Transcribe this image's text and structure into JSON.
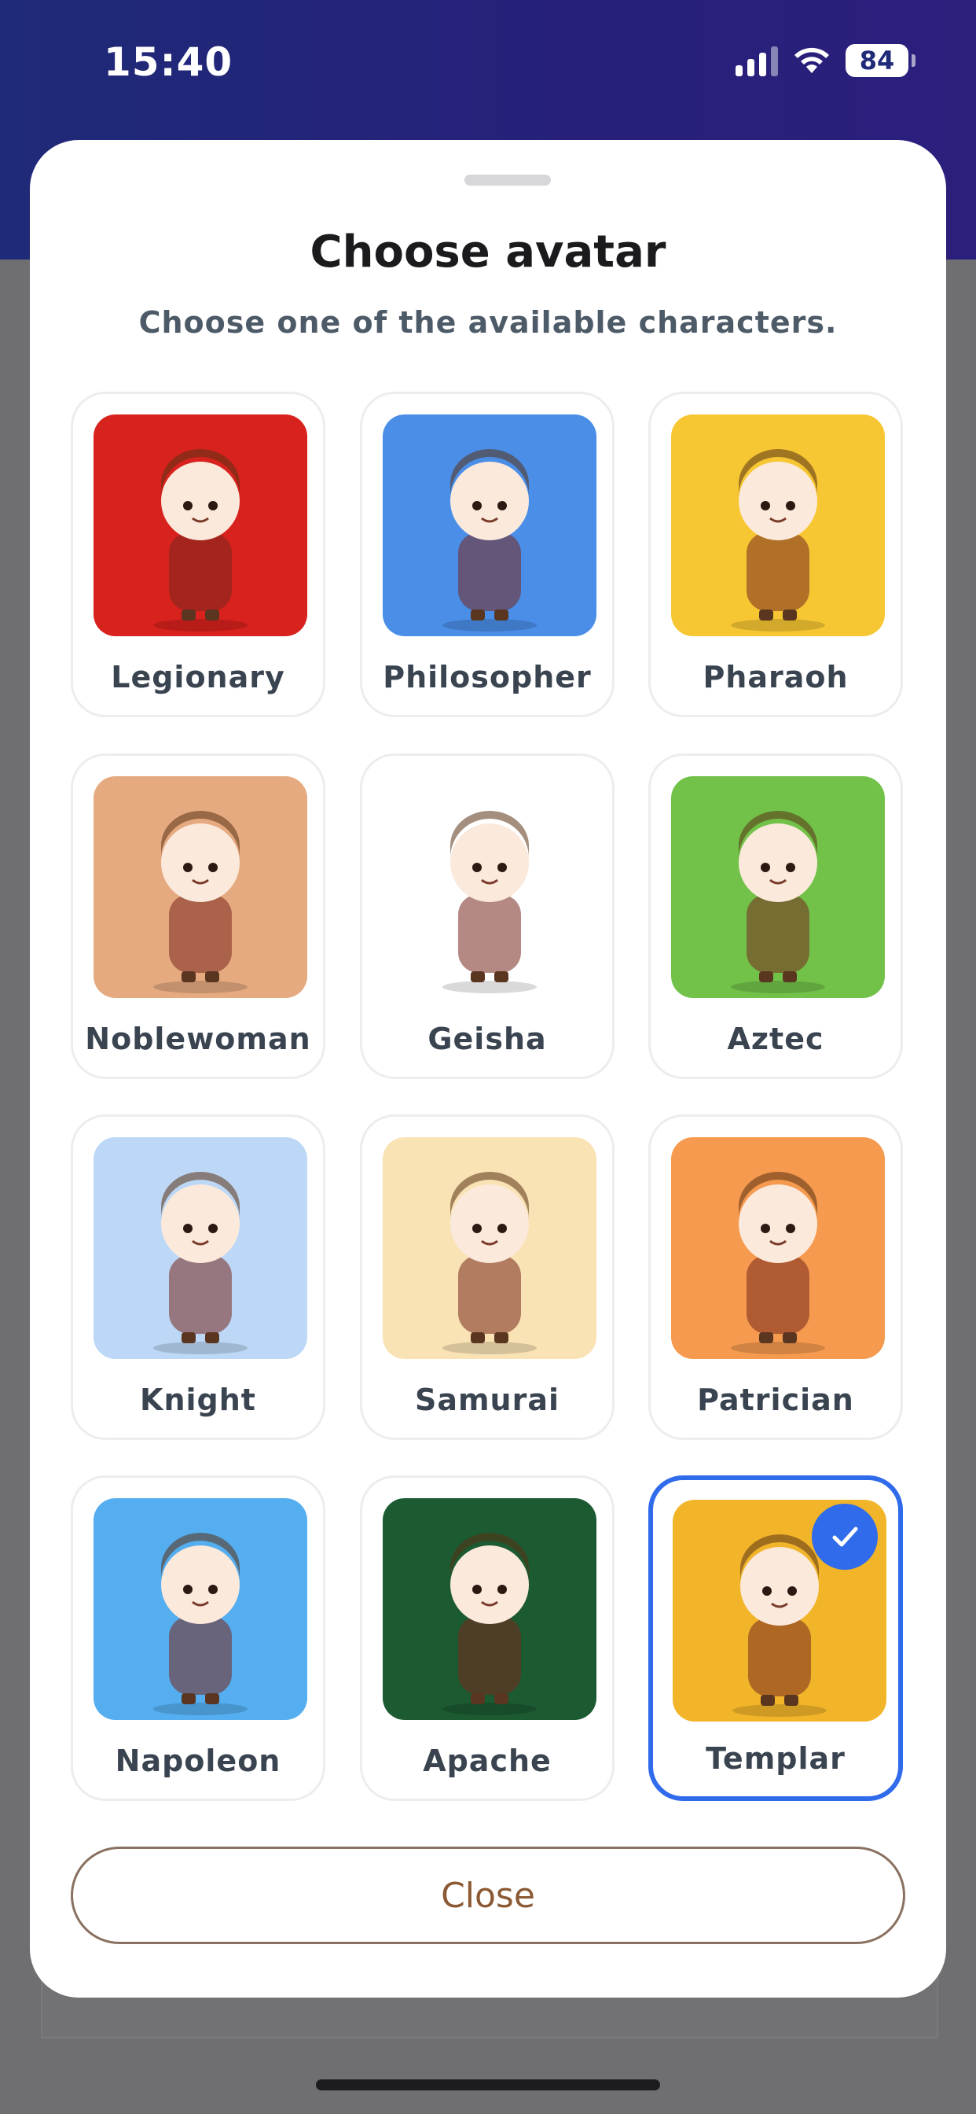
{
  "status_bar": {
    "time": "15:40",
    "battery": "84"
  },
  "sheet": {
    "title": "Choose avatar",
    "subtitle": "Choose one of the available characters.",
    "selected_avatar": "Templar",
    "close_label": "Close"
  },
  "avatars": [
    {
      "label": "Legionary",
      "bg": "#d8221e"
    },
    {
      "label": "Philosopher",
      "bg": "#4a8ee8"
    },
    {
      "label": "Pharaoh",
      "bg": "#f7c733"
    },
    {
      "label": "Noblewoman",
      "bg": "#e6aa80"
    },
    {
      "label": "Geisha",
      "bg": "#ffffff"
    },
    {
      "label": "Aztec",
      "bg": "#72c24a"
    },
    {
      "label": "Knight",
      "bg": "#bcd8f6"
    },
    {
      "label": "Samurai",
      "bg": "#f9e2b4"
    },
    {
      "label": "Patrician",
      "bg": "#f59a4e"
    },
    {
      "label": "Napoleon",
      "bg": "#55aef0"
    },
    {
      "label": "Apache",
      "bg": "#1c5a32"
    },
    {
      "label": "Templar",
      "bg": "#f2b52a"
    }
  ],
  "colors": {
    "accent": "#2f6bea",
    "close_text": "#8b5a34",
    "header_gradient": [
      "#1f2a78",
      "#2b1f7c"
    ]
  }
}
